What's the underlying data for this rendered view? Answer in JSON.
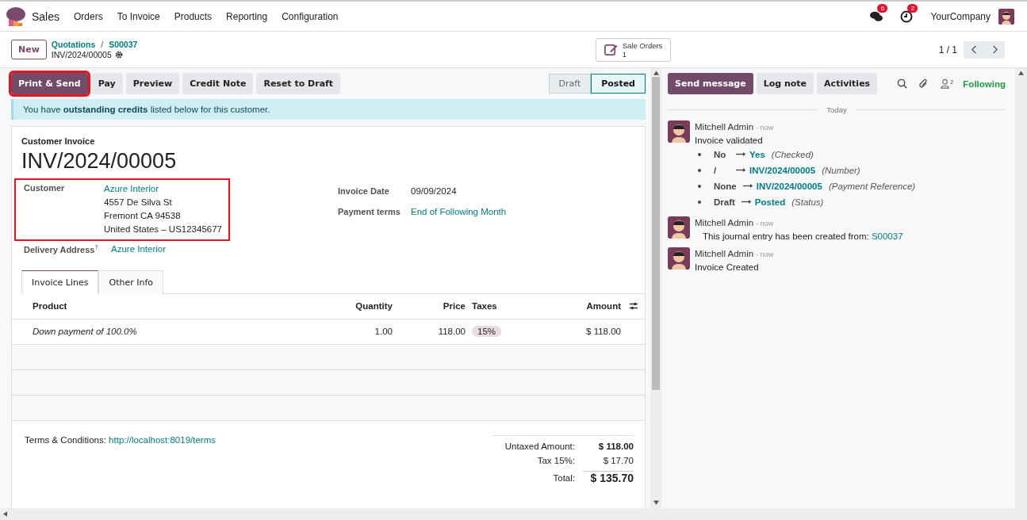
{
  "navbar": {
    "app": "Sales",
    "menu": [
      "Orders",
      "To Invoice",
      "Products",
      "Reporting",
      "Configuration"
    ],
    "messages_count": "6",
    "activities_count": "2",
    "company": "YourCompany"
  },
  "control_panel": {
    "new_button": "New",
    "breadcrumbs": [
      "Quotations",
      "S00037"
    ],
    "separator": "/",
    "record": "INV/2024/00005",
    "smart_button": {
      "label": "Sale Orders",
      "count": "1"
    },
    "pager": "1 / 1"
  },
  "actions": [
    {
      "label": "Print & Send",
      "primary": true,
      "highlighted": true
    },
    {
      "label": "Pay",
      "primary": false,
      "highlighted": false
    },
    {
      "label": "Preview",
      "primary": false,
      "highlighted": false
    },
    {
      "label": "Credit Note",
      "primary": false,
      "highlighted": false
    },
    {
      "label": "Reset to Draft",
      "primary": false,
      "highlighted": false
    }
  ],
  "statusbar": [
    {
      "label": "Draft",
      "selected": false
    },
    {
      "label": "Posted",
      "selected": true
    }
  ],
  "alert": "You have **outstanding credits** listed below for this customer.",
  "form": {
    "type": "Customer Invoice",
    "name": "INV/2024/00005",
    "customer": {
      "label": "Customer",
      "name": "Azure Interior",
      "address": [
        "4557 De Silva St",
        "Fremont CA 94538",
        "United States – US12345677"
      ],
      "highlighted": true
    },
    "delivery": {
      "label": "Delivery Address",
      "help": "?",
      "value": "Azure Interior"
    },
    "right_fields": [
      {
        "label": "Invoice Date",
        "value": "09/09/2024",
        "link": false
      },
      {
        "label": "Payment terms",
        "value": "End of Following Month",
        "link": true
      }
    ],
    "tabs": [
      {
        "label": "Invoice Lines",
        "selected": true
      },
      {
        "label": "Other Info",
        "selected": false
      }
    ],
    "columns": [
      "Product",
      "Quantity",
      "Price",
      "Taxes",
      "Amount"
    ],
    "lines": [
      {
        "product": "Down payment of 100.0%",
        "quantity": "1.00",
        "price": "118.00",
        "tax": "15%",
        "amount": "$ 118.00"
      }
    ],
    "terms_label": "Terms & Conditions:",
    "terms_link": "http://localhost:8019/terms",
    "totals": [
      {
        "label": "Untaxed Amount:",
        "value": "$ 118.00",
        "kind": "bold"
      },
      {
        "label": "Tax 15%:",
        "value": "$ 17.70",
        "kind": "plain"
      },
      {
        "label": "Total:",
        "value": "$ 135.70",
        "kind": "grand"
      }
    ]
  },
  "chatter": {
    "buttons": [
      {
        "label": "Send message",
        "primary": true
      },
      {
        "label": "Log note",
        "primary": false
      },
      {
        "label": "Activities",
        "primary": false
      }
    ],
    "followers_count": "2",
    "follow_label": "Following",
    "day": "Today",
    "messages": [
      {
        "author": "Mitchell Admin",
        "time": "- now",
        "kind": "tracking",
        "body": "Invoice validated",
        "changes": [
          {
            "old": "No",
            "new": "Yes",
            "field": "(Checked)"
          },
          {
            "old": "/",
            "new": "INV/2024/00005",
            "field": "(Number)"
          },
          {
            "old": "None",
            "new": "INV/2024/00005",
            "field": "(Payment Reference)"
          },
          {
            "old": "Draft",
            "new": "Posted",
            "field": "(Status)"
          }
        ]
      },
      {
        "author": "Mitchell Admin",
        "time": "- now",
        "kind": "link",
        "body": "This journal entry has been created from:",
        "link": "S00037"
      },
      {
        "author": "Mitchell Admin",
        "time": "- now",
        "kind": "text",
        "body": "Invoice Created"
      }
    ]
  }
}
